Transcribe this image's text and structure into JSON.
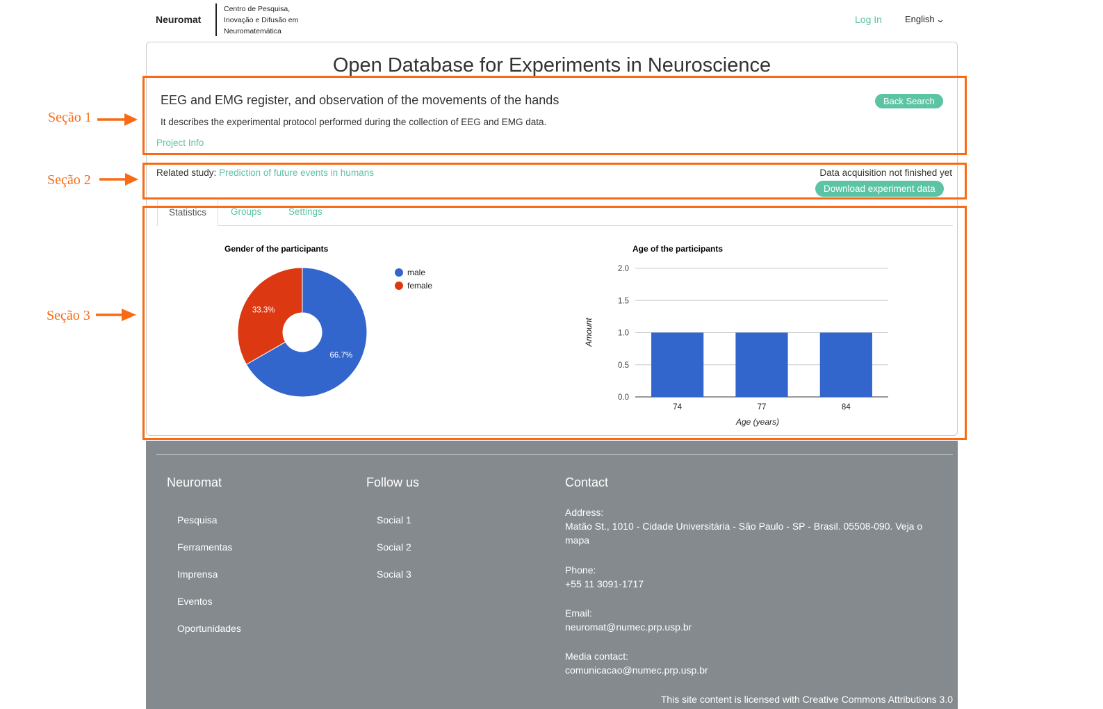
{
  "header": {
    "brand": "Neuromat",
    "brand_sub": "Centro de Pesquisa, Inovação e Difusão em Neuromatemática",
    "login": "Log In",
    "language": "English",
    "language_icon": "chevron-down-icon"
  },
  "page": {
    "title": "Open Database for Experiments in Neuroscience"
  },
  "experiment": {
    "title": "EEG and EMG register, and observation of the movements of the hands",
    "description": "It describes the experimental protocol performed during the collection of EEG and EMG data.",
    "back_button": "Back Search",
    "project_info": "Project Info",
    "related_label": "Related study:",
    "related_link": "Prediction of future events in humans",
    "acquisition_status": "Data acquisition not finished yet",
    "download_button": "Download experiment data"
  },
  "tabs": [
    {
      "label": "Statistics",
      "active": true
    },
    {
      "label": "Groups",
      "active": false
    },
    {
      "label": "Settings",
      "active": false
    }
  ],
  "annotations": [
    "Seção 1",
    "Seção 2",
    "Seção 3"
  ],
  "colors": {
    "accent": "#5cc3a4",
    "annotation": "#f96a12",
    "male": "#3366cc",
    "female": "#dc3912",
    "footer_bg": "#848a8e"
  },
  "chart_data": [
    {
      "type": "pie",
      "title": "Gender of the participants",
      "donut": true,
      "categories": [
        "male",
        "female"
      ],
      "values": [
        66.7,
        33.3
      ],
      "labels": [
        "66.7%",
        "33.3%"
      ],
      "colors": [
        "#3366cc",
        "#dc3912"
      ],
      "legend": "right"
    },
    {
      "type": "bar",
      "title": "Age of the participants",
      "categories": [
        "74",
        "77",
        "84"
      ],
      "values": [
        1,
        1,
        1
      ],
      "xlabel": "Age (years)",
      "ylabel": "Amount",
      "ylim": [
        0,
        2
      ],
      "yticks": [
        "0.0",
        "0.5",
        "1.0",
        "1.5",
        "2.0"
      ],
      "grid": true,
      "color": "#3366cc"
    }
  ],
  "footer": {
    "col1": {
      "heading": "Neuromat",
      "links": [
        "Pesquisa",
        "Ferramentas",
        "Imprensa",
        "Eventos",
        "Oportunidades"
      ]
    },
    "col2": {
      "heading": "Follow us",
      "links": [
        "Social 1",
        "Social 2",
        "Social 3"
      ]
    },
    "col3": {
      "heading": "Contact",
      "address_label": "Address:",
      "address": "Matão St., 1010 - Cidade Universitária - São Paulo - SP - Brasil. 05508-090.",
      "address_link": "Veja o mapa",
      "phone_label": "Phone:",
      "phone": "+55 11 3091-1717",
      "email_label": "Email:",
      "email": "neuromat@numec.prp.usp.br",
      "media_label": "Media contact:",
      "media": "comunicacao@numec.prp.usp.br"
    },
    "license": "This site content is licensed with Creative Commons Attributions 3.0"
  }
}
